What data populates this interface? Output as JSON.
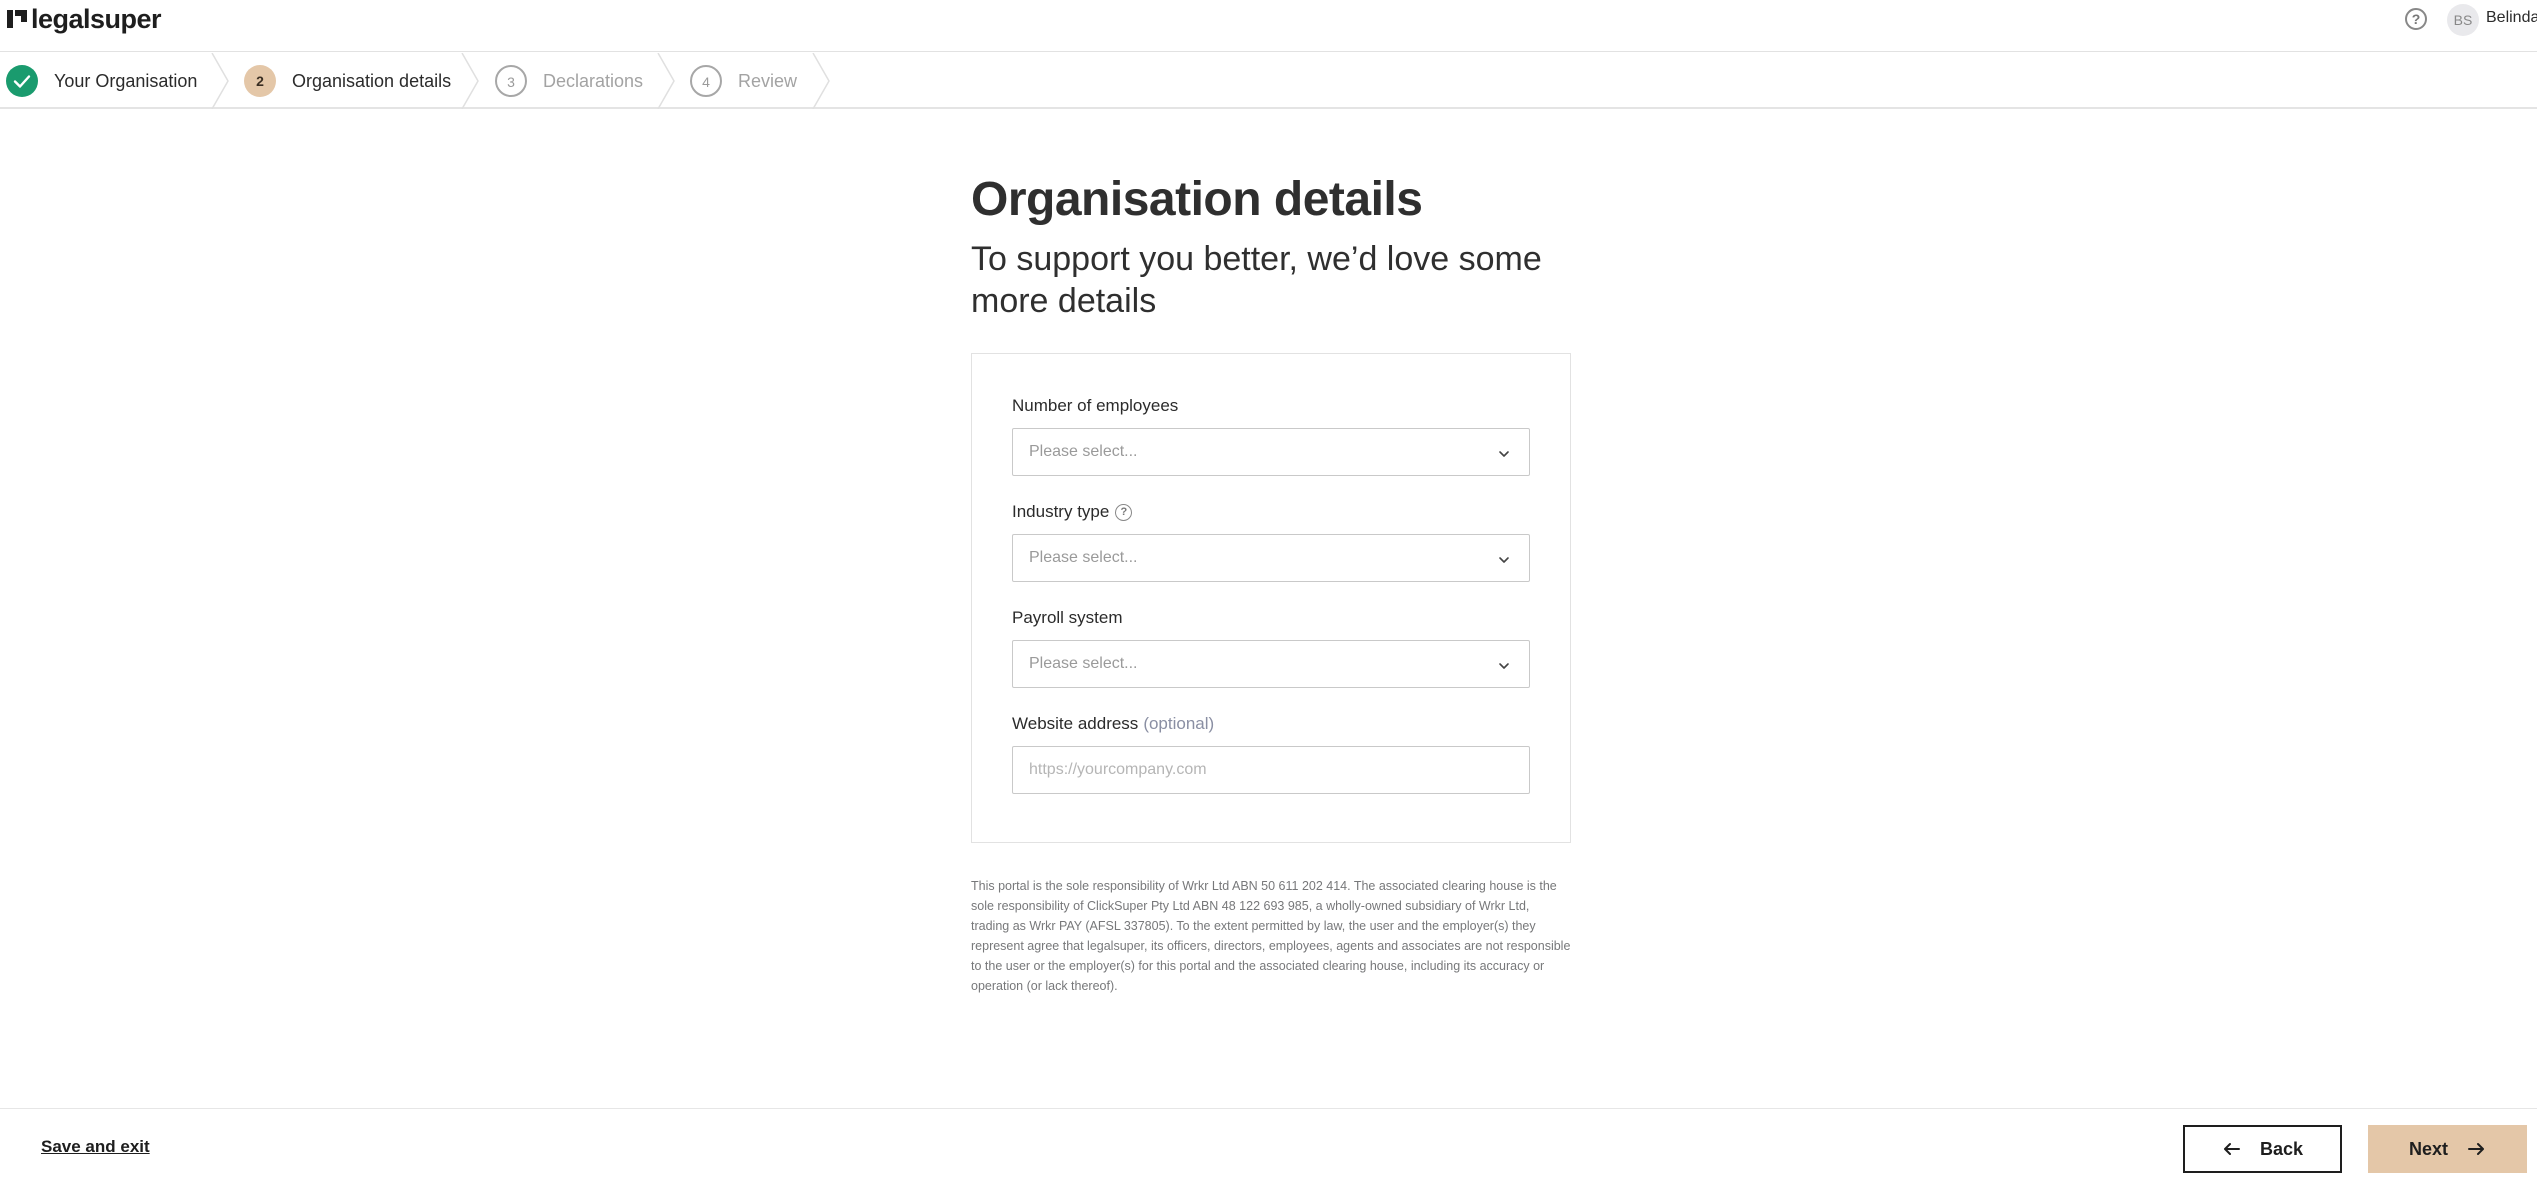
{
  "header": {
    "logo_text": "legalsuper",
    "avatar_initials": "BS",
    "user_name": "Belinda"
  },
  "stepper": {
    "steps": [
      {
        "number": "",
        "label": "Your Organisation",
        "state": "complete"
      },
      {
        "number": "2",
        "label": "Organisation details",
        "state": "active"
      },
      {
        "number": "3",
        "label": "Declarations",
        "state": "upcoming"
      },
      {
        "number": "4",
        "label": "Review",
        "state": "upcoming"
      }
    ]
  },
  "main": {
    "title": "Organisation details",
    "subtitle": "To support you better, we’d love some more details"
  },
  "form": {
    "employees": {
      "label": "Number of employees",
      "value": "Please select..."
    },
    "industry": {
      "label": "Industry type",
      "value": "Please select..."
    },
    "payroll": {
      "label": "Payroll system",
      "value": "Please select..."
    },
    "website": {
      "label": "Website address",
      "optional": "(optional)",
      "placeholder": "https://yourcompany.com",
      "value": ""
    }
  },
  "disclaimer": "This portal is the sole responsibility of Wrkr Ltd ABN 50 611 202 414. The associated clearing house is the sole responsibility of ClickSuper Pty Ltd ABN 48 122 693 985, a wholly-owned subsidiary of Wrkr Ltd, trading as Wrkr PAY (AFSL 337805). To the extent permitted by law, the user and the employer(s) they represent agree that legalsuper, its officers, directors, employees, agents and associates are not responsible to the user or the employer(s) for this portal and the associated clearing house, including its accuracy or operation (or lack thereof).",
  "footer": {
    "save_exit_label": "Save and exit",
    "back_label": "Back",
    "next_label": "Next"
  },
  "colors": {
    "accent": "#e4c7a8",
    "success": "#1a9b6e",
    "text": "#2b2b2b",
    "muted": "#a3a3a3"
  },
  "icons": [
    "logo-mark-icon",
    "help-icon",
    "check-icon",
    "chevron-right-separator-icon",
    "chevron-down-icon",
    "arrow-left-icon",
    "arrow-right-icon"
  ]
}
